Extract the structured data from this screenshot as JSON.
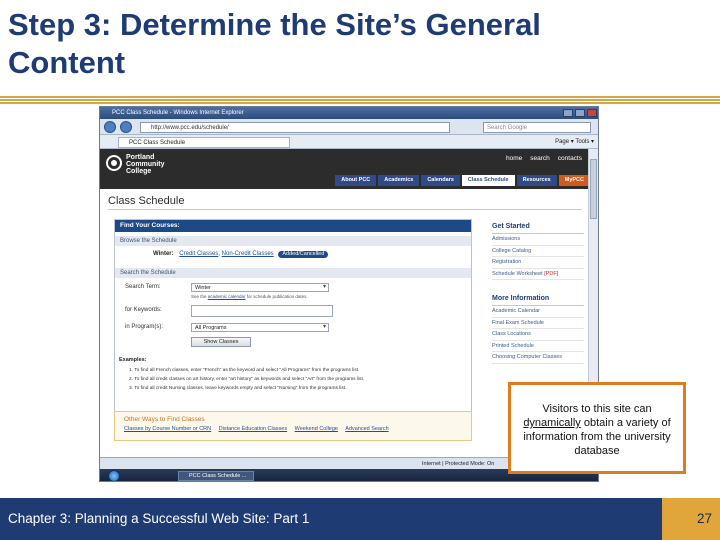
{
  "slide": {
    "title": "Step 3: Determine the Site’s General Content",
    "footer_text": "Chapter 3: Planning a Successful Web Site: Part 1",
    "page_number": "27",
    "callout": {
      "text_before": "Visitors to this site can ",
      "underlined": "dynamically",
      "text_after": " obtain a variety of information from  the university database"
    },
    "accent_colors": {
      "title": "#1f3b73",
      "rule": "#d4a84a",
      "callout_border": "#e07b1f",
      "footer": "#1f3b73",
      "page_box": "#e0a63c"
    }
  },
  "browser": {
    "window_title": "PCC Class Schedule - Windows Internet Explorer",
    "address": "http://www.pcc.edu/schedule/",
    "search_placeholder": "Search Google",
    "tab_label": "PCC Class Schedule",
    "tools": "Page ▾  Tools ▾",
    "status_text": "Internet | Protected Mode: On",
    "taskbar_item": "PCC Class Schedule ..."
  },
  "site": {
    "logo_text": "Portland Community College",
    "util_links": [
      "home",
      "search",
      "contacts"
    ],
    "nav": [
      {
        "label": "About PCC",
        "state": "normal"
      },
      {
        "label": "Academics",
        "state": "normal"
      },
      {
        "label": "Calendars",
        "state": "normal"
      },
      {
        "label": "Class Schedule",
        "state": "active"
      },
      {
        "label": "Resources",
        "state": "normal"
      },
      {
        "label": "MyPCC",
        "state": "highlight"
      }
    ],
    "heading": "Class Schedule",
    "find": {
      "header": "Find Your Courses:",
      "browse_label": "Browse the Schedule",
      "term_label": "Winter:",
      "term_links": [
        "Credit Classes",
        "Non-Credit Classes"
      ],
      "term_pill": "Added/Cancelled",
      "search_label": "Search the Schedule",
      "term_field_label": "Search Term:",
      "term_value": "Winter",
      "term_hint_before": "See the ",
      "term_hint_link": "academic calendar",
      "term_hint_after": " for schedule publication dates.",
      "keywords_label": "for Keywords:",
      "keywords_value": "",
      "programs_label": "in Program(s):",
      "programs_value": "All Programs",
      "show_button": "Show Classes",
      "examples_label": "Examples:",
      "examples": [
        "1.   To find all French classes, enter \"French\" as the keyword and select \"All Programs\" from the programs list.",
        "2.   To find all credit classes on art history, enter \"art history\" as keywords and select \"Art\" from the programs list.",
        "3.   To find all credit Nursing classes, leave keywords empty and select \"Nursing\" from the programs list."
      ]
    },
    "other": {
      "header": "Other Ways to Find Classes",
      "links": [
        "Classes by Course Number or CRN",
        "Distance Education Classes",
        "Weekend College",
        "Advanced Search"
      ]
    },
    "sidebar": {
      "getting_started": {
        "header": "Get Started",
        "items": [
          "Admissions",
          "College Catalog",
          "Registration"
        ],
        "worksheet": "Schedule Worksheet",
        "worksheet_tag": "[PDF]"
      },
      "more_info": {
        "header": "More Information",
        "items": [
          "Academic Calendar",
          "Final Exam Schedule",
          "Class Locations",
          "Printed Schedule",
          "Choosing Computer Classes"
        ]
      }
    }
  }
}
